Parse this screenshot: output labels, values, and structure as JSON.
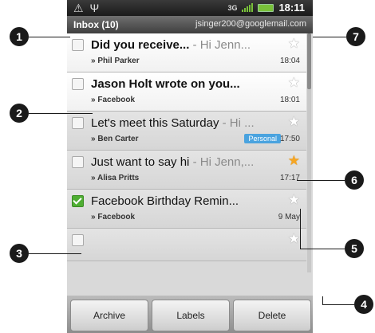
{
  "status_bar": {
    "left_icons": [
      "warning-icon",
      "usb-icon"
    ],
    "network": "3G",
    "time": "18:11"
  },
  "title_bar": {
    "inbox": "Inbox (10)",
    "account": "jsinger200@googlemail.com"
  },
  "messages": [
    {
      "subject": "Did you receive...",
      "snippet": " - Hi Jenn...",
      "from": "» Phil Parker",
      "time": "18:04",
      "unread": true,
      "starred": false,
      "checked": false,
      "label": ""
    },
    {
      "subject": "Jason Holt wrote on you...",
      "snippet": "",
      "from": "» Facebook",
      "time": "18:01",
      "unread": true,
      "starred": false,
      "checked": false,
      "label": ""
    },
    {
      "subject": "Let's meet this Saturday",
      "snippet": " - Hi ...",
      "from": "» Ben Carter",
      "time": "17:50",
      "unread": false,
      "starred": false,
      "checked": false,
      "label": "Personal"
    },
    {
      "subject": "Just want to say hi",
      "snippet": " - Hi Jenn,...",
      "from": "» Alisa Pritts",
      "time": "17:17",
      "unread": false,
      "starred": true,
      "checked": false,
      "label": ""
    },
    {
      "subject": "Facebook Birthday Remin...",
      "snippet": "",
      "from": "» Facebook",
      "time": "9 May",
      "unread": false,
      "starred": false,
      "checked": true,
      "label": ""
    }
  ],
  "bottom_bar": {
    "archive": "Archive",
    "labels": "Labels",
    "delete": "Delete"
  },
  "callouts": [
    "1",
    "2",
    "3",
    "4",
    "5",
    "6",
    "7"
  ]
}
